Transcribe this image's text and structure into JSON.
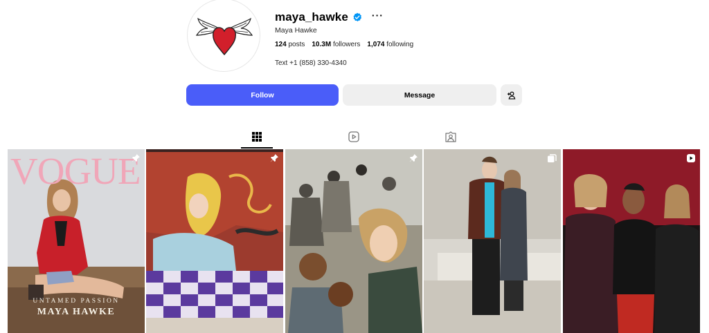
{
  "profile": {
    "username": "maya_hawke",
    "full_name": "Maya Hawke",
    "more_label": "···",
    "stats": {
      "posts_count": "124",
      "posts_label": "posts",
      "followers_count": "10.3M",
      "followers_label": "followers",
      "following_count": "1,074",
      "following_label": "following"
    },
    "bio": "Text +1 (858) 330-4340",
    "verified_color": "#0095f6"
  },
  "actions": {
    "follow_label": "Follow",
    "message_label": "Message",
    "follow_color": "#4a5df9"
  },
  "tabs": [
    {
      "name": "posts",
      "icon": "grid-icon",
      "active": true
    },
    {
      "name": "reels",
      "icon": "reels-icon",
      "active": false
    },
    {
      "name": "tagged",
      "icon": "tagged-icon",
      "active": false
    }
  ],
  "posts": [
    {
      "badge": "pin-icon",
      "cover_title": "VOGUE",
      "cover_tag": "UNTAMED PASSION",
      "cover_name": "MAYA HAWKE"
    },
    {
      "badge": "pin-icon"
    },
    {
      "badge": "pin-icon"
    },
    {
      "badge": "carousel-icon"
    },
    {
      "badge": "reel-icon"
    }
  ]
}
